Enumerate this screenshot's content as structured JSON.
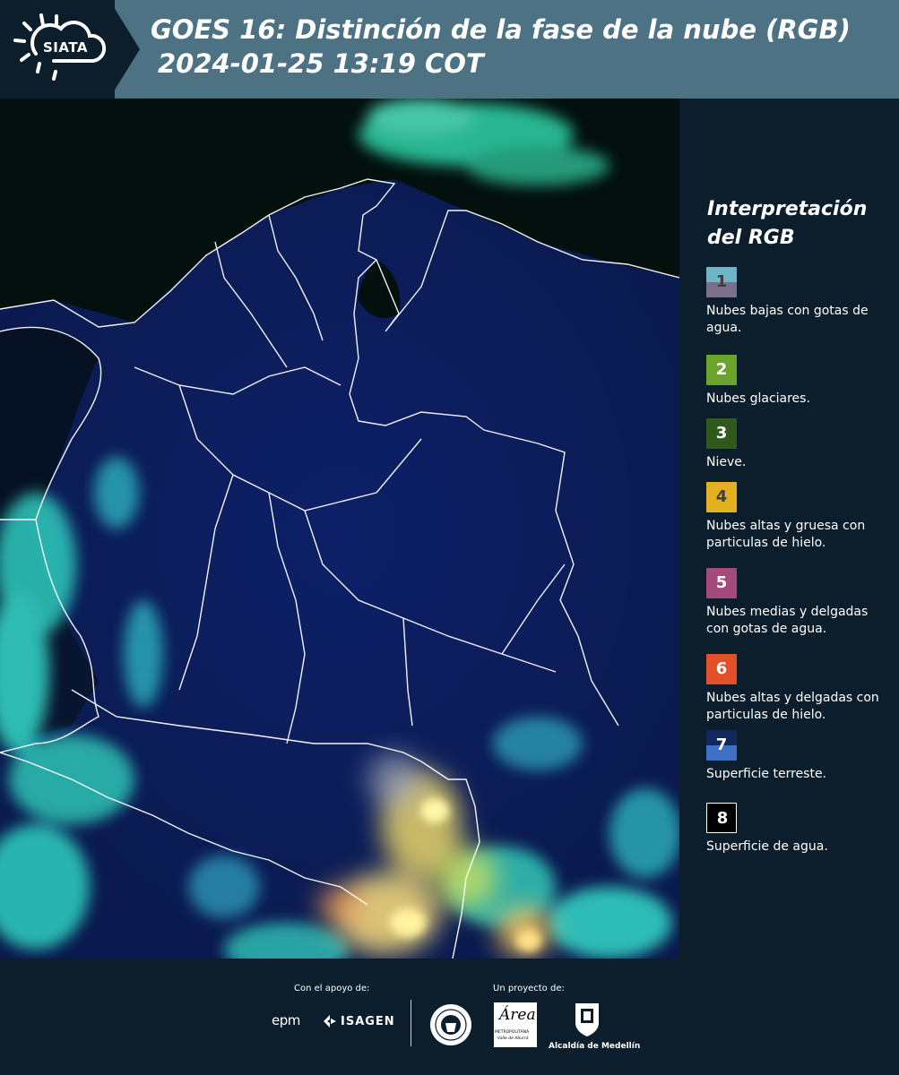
{
  "header": {
    "logo_text": "SIATA",
    "title_line1": "GOES 16: Distinción de la fase de la nube (RGB)",
    "title_line2": "2024-01-25 13:19 COT"
  },
  "legend": {
    "title_line1": "Interpretación",
    "title_line2": "del RGB",
    "items": [
      {
        "number": "1",
        "label": "Nubes bajas con gotas de agua.",
        "color_top": "#6fb5c6",
        "color_bottom": "#7b6f8e",
        "number_color": "#3e3e3e"
      },
      {
        "number": "2",
        "label": "Nubes glaciares.",
        "color_top": "#6aa42c",
        "color_bottom": "#6aa42c",
        "number_color": "#ffffff"
      },
      {
        "number": "3",
        "label": "Nieve.",
        "color_top": "#2f5a1c",
        "color_bottom": "#2f5a1c",
        "number_color": "#ffffff"
      },
      {
        "number": "4",
        "label": "Nubes altas y gruesa con particulas de hielo.",
        "color_top": "#e3b01f",
        "color_bottom": "#e3b01f",
        "number_color": "#3e3e3e"
      },
      {
        "number": "5",
        "label": "Nubes medias y delgadas con gotas de agua.",
        "color_top": "#a34a7a",
        "color_bottom": "#a34a7a",
        "number_color": "#ffffff"
      },
      {
        "number": "6",
        "label": "Nubes altas y delgadas con particulas de hielo.",
        "color_top": "#e2502a",
        "color_bottom": "#e2502a",
        "number_color": "#ffffff"
      },
      {
        "number": "7",
        "label": "Superficie terreste.",
        "color_top": "#13275f",
        "color_bottom": "#3e70c4",
        "number_color": "#ffffff"
      },
      {
        "number": "8",
        "label": "Superficie de agua.",
        "color_top": "#000000",
        "color_bottom": "#000000",
        "number_color": "#ffffff"
      }
    ]
  },
  "footer": {
    "support_label": "Con el apoyo de:",
    "project_label": "Un proyecto de:",
    "partners": {
      "epm": "epm",
      "isagen": "ISAGEN",
      "metropolitana_logo_text": "Área",
      "metropolitana_sub": "METROPOLITANA",
      "metropolitana_sub2": "Valle de Aburrá",
      "alcaldia": "Alcaldía de Medellín"
    }
  },
  "colors": {
    "header_bg": "#4c7283",
    "page_bg": "#0c1e2c",
    "land": "#0f2466",
    "ocean": "#061124",
    "cloud_cyan": "#3ee6c8",
    "cloud_yellow": "#f3d96a"
  }
}
